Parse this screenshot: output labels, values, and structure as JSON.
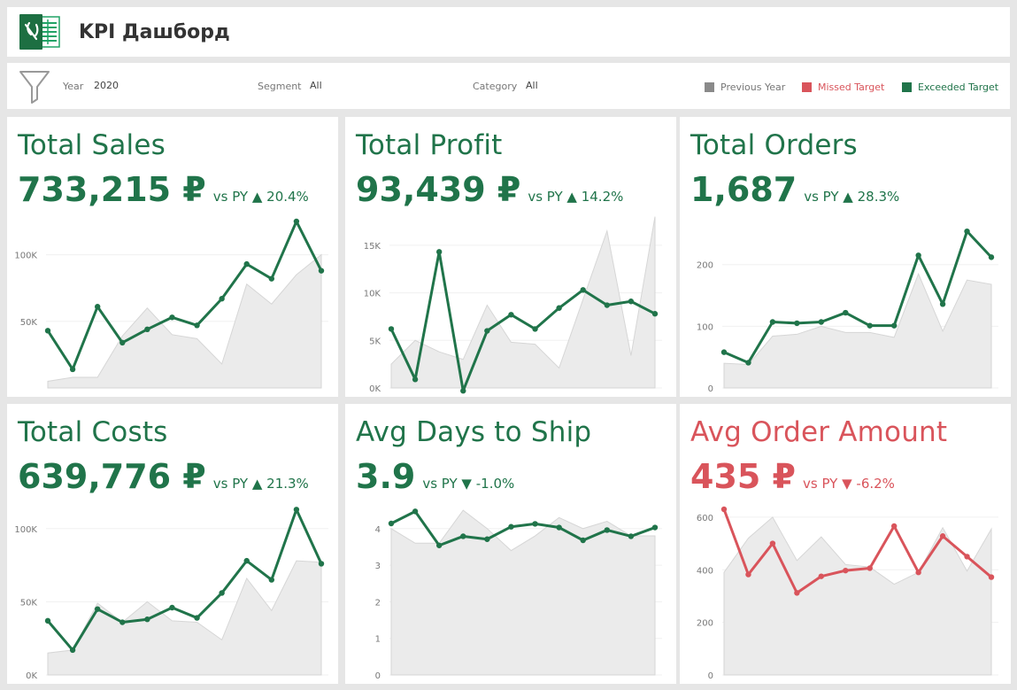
{
  "header": {
    "title": "KPI Дашборд",
    "logo_icon": "excel-logo-icon"
  },
  "filters": [
    {
      "label": "Year",
      "value": "2020"
    },
    {
      "label": "Segment",
      "value": "All"
    },
    {
      "label": "Category",
      "value": "All"
    }
  ],
  "legend": [
    {
      "label": "Previous Year",
      "color": "#8a8a8a"
    },
    {
      "label": "Missed Target",
      "color": "#d9545b"
    },
    {
      "label": "Exceeded Target",
      "color": "#20744a"
    }
  ],
  "colors": {
    "good": "#20744a",
    "bad": "#d9545b",
    "previous_year_fill": "#ebebeb"
  },
  "chart_data": [
    {
      "type": "line",
      "title": "Total Sales",
      "value": "733,215 ₽",
      "comparison": "vs PY ▲ 20.4%",
      "status": "exceeded",
      "ylim": [
        0,
        125000
      ],
      "yticks": [
        {
          "v": 50000,
          "label": "50K"
        },
        {
          "v": 100000,
          "label": "100K"
        }
      ],
      "series": [
        {
          "values": [
            43000,
            14000,
            61000,
            34000,
            44000,
            53000,
            47000,
            67000,
            93000,
            82000,
            125000,
            88000
          ]
        },
        {
          "name": "Previous Year",
          "values": [
            5000,
            8000,
            8000,
            39000,
            60000,
            40000,
            37000,
            18000,
            78000,
            63000,
            85000,
            100000
          ]
        }
      ]
    },
    {
      "type": "line",
      "title": "Total Profit",
      "value": "93,439 ₽",
      "comparison": "vs PY ▲ 14.2%",
      "status": "exceeded",
      "ylim": [
        0,
        17500
      ],
      "yticks": [
        {
          "v": 0,
          "label": "0K"
        },
        {
          "v": 5000,
          "label": "5K"
        },
        {
          "v": 10000,
          "label": "10K"
        },
        {
          "v": 15000,
          "label": "15K"
        }
      ],
      "series": [
        {
          "values": [
            6200,
            900,
            14300,
            -300,
            6000,
            7700,
            6200,
            8400,
            10300,
            8700,
            9100,
            7800
          ]
        },
        {
          "name": "Previous Year",
          "values": [
            2500,
            5000,
            3800,
            3000,
            8700,
            4800,
            4600,
            2100,
            9300,
            16500,
            3400,
            18000
          ]
        }
      ]
    },
    {
      "type": "line",
      "title": "Total Orders",
      "value": "1,687",
      "comparison": "vs PY ▲ 28.3%",
      "status": "exceeded",
      "ylim": [
        0,
        270
      ],
      "yticks": [
        {
          "v": 0,
          "label": "0"
        },
        {
          "v": 100,
          "label": "100"
        },
        {
          "v": 200,
          "label": "200"
        }
      ],
      "series": [
        {
          "values": [
            58,
            41,
            107,
            105,
            107,
            122,
            101,
            101,
            215,
            136,
            254,
            212
          ]
        },
        {
          "name": "Previous Year",
          "values": [
            40,
            38,
            84,
            87,
            100,
            90,
            90,
            82,
            185,
            92,
            175,
            168
          ]
        }
      ]
    },
    {
      "type": "line",
      "title": "Total Costs",
      "value": "639,776 ₽",
      "comparison": "vs PY ▲ 21.3%",
      "status": "exceeded",
      "ylim": [
        0,
        115000
      ],
      "yticks": [
        {
          "v": 0,
          "label": "0K"
        },
        {
          "v": 50000,
          "label": "50K"
        },
        {
          "v": 100000,
          "label": "100K"
        }
      ],
      "series": [
        {
          "values": [
            37000,
            17000,
            45000,
            36000,
            38000,
            46000,
            39000,
            56000,
            78000,
            65000,
            113000,
            76000
          ]
        },
        {
          "name": "Previous Year",
          "values": [
            15000,
            17000,
            49000,
            36000,
            50000,
            37000,
            36000,
            24000,
            66000,
            44000,
            78000,
            77000
          ]
        }
      ]
    },
    {
      "type": "line",
      "title": "Avg Days to Ship",
      "value": "3.9",
      "comparison": "vs PY ▼ -1.0%",
      "status": "exceeded",
      "ylim": [
        0,
        4.6
      ],
      "yticks": [
        {
          "v": 0,
          "label": "0"
        },
        {
          "v": 1,
          "label": "1"
        },
        {
          "v": 2,
          "label": "2"
        },
        {
          "v": 3,
          "label": "3"
        },
        {
          "v": 4,
          "label": "4"
        }
      ],
      "series": [
        {
          "values": [
            4.14,
            4.47,
            3.54,
            3.79,
            3.71,
            4.05,
            4.13,
            4.03,
            3.68,
            3.96,
            3.79,
            4.03
          ]
        },
        {
          "name": "Previous Year",
          "values": [
            4.0,
            3.6,
            3.6,
            4.5,
            4.0,
            3.4,
            3.8,
            4.3,
            4.0,
            4.2,
            3.8,
            3.8
          ]
        }
      ]
    },
    {
      "type": "line",
      "title": "Avg Order Amount",
      "value": "435 ₽",
      "comparison": "vs PY ▼ -6.2%",
      "status": "missed",
      "ylim": [
        0,
        640
      ],
      "yticks": [
        {
          "v": 0,
          "label": "0"
        },
        {
          "v": 200,
          "label": "200"
        },
        {
          "v": 400,
          "label": "400"
        },
        {
          "v": 600,
          "label": "600"
        }
      ],
      "series": [
        {
          "values": [
            630,
            382,
            500,
            312,
            375,
            397,
            406,
            566,
            390,
            528,
            450,
            372
          ]
        },
        {
          "name": "Previous Year",
          "values": [
            390,
            520,
            600,
            435,
            525,
            420,
            410,
            345,
            390,
            560,
            395,
            555
          ]
        }
      ]
    }
  ]
}
